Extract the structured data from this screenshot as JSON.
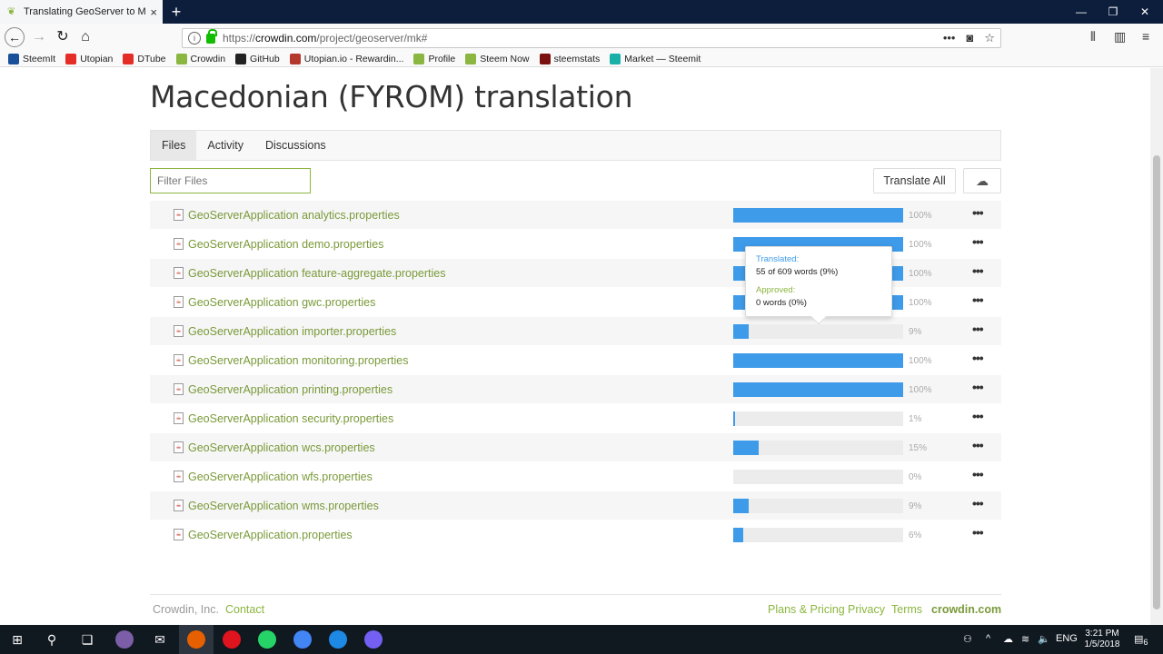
{
  "browser": {
    "tab_title": "Translating GeoServer to Macedonian",
    "url_prefix": "https://",
    "url_host": "crowdin.com",
    "url_path": "/project/geoserver/mk#",
    "bookmarks": [
      "SteemIt",
      "Utopian",
      "DTube",
      "Crowdin",
      "GitHub",
      "Utopian.io - Rewardin...",
      "Profile",
      "Steem Now",
      "steemstats",
      "Market — Steemit"
    ],
    "bookmark_colors": [
      "#1a5099",
      "#e52d27",
      "#e52d27",
      "#8bb63f",
      "#222222",
      "#b4382b",
      "#8bb63f",
      "#8bb63f",
      "#7a1010",
      "#1ab0a8"
    ]
  },
  "page": {
    "title": "Macedonian (FYROM) translation",
    "tabs": [
      "Files",
      "Activity",
      "Discussions"
    ],
    "filter_placeholder": "Filter Files",
    "translate_all": "Translate All"
  },
  "files": [
    {
      "name": "GeoServerApplication analytics.properties",
      "percent": 100,
      "label": "100%"
    },
    {
      "name": "GeoServerApplication demo.properties",
      "percent": 100,
      "label": "100%"
    },
    {
      "name": "GeoServerApplication feature-aggregate.properties",
      "percent": 100,
      "label": "100%"
    },
    {
      "name": "GeoServerApplication gwc.properties",
      "percent": 100,
      "label": "100%"
    },
    {
      "name": "GeoServerApplication importer.properties",
      "percent": 9,
      "label": "9%"
    },
    {
      "name": "GeoServerApplication monitoring.properties",
      "percent": 100,
      "label": "100%"
    },
    {
      "name": "GeoServerApplication printing.properties",
      "percent": 100,
      "label": "100%"
    },
    {
      "name": "GeoServerApplication security.properties",
      "percent": 1,
      "label": "1%"
    },
    {
      "name": "GeoServerApplication wcs.properties",
      "percent": 15,
      "label": "15%"
    },
    {
      "name": "GeoServerApplication wfs.properties",
      "percent": 0,
      "label": "0%"
    },
    {
      "name": "GeoServerApplication wms.properties",
      "percent": 9,
      "label": "9%"
    },
    {
      "name": "GeoServerApplication.properties",
      "percent": 6,
      "label": "6%"
    }
  ],
  "tooltip": {
    "translated_label": "Translated:",
    "translated_value": "55 of 609 words (9%)",
    "approved_label": "Approved:",
    "approved_value": "0 words (0%)"
  },
  "footer": {
    "company": "Crowdin, Inc.",
    "contact": "Contact",
    "plans": "Plans & Pricing",
    "privacy": "Privacy",
    "terms": "Terms",
    "brand": "crowdin.com"
  },
  "taskbar": {
    "lang": "ENG",
    "time": "3:21 PM",
    "date": "1/5/2018",
    "notifications": "6"
  },
  "colors": {
    "accent_green": "#8bb63f",
    "progress_blue": "#3e9be9"
  }
}
